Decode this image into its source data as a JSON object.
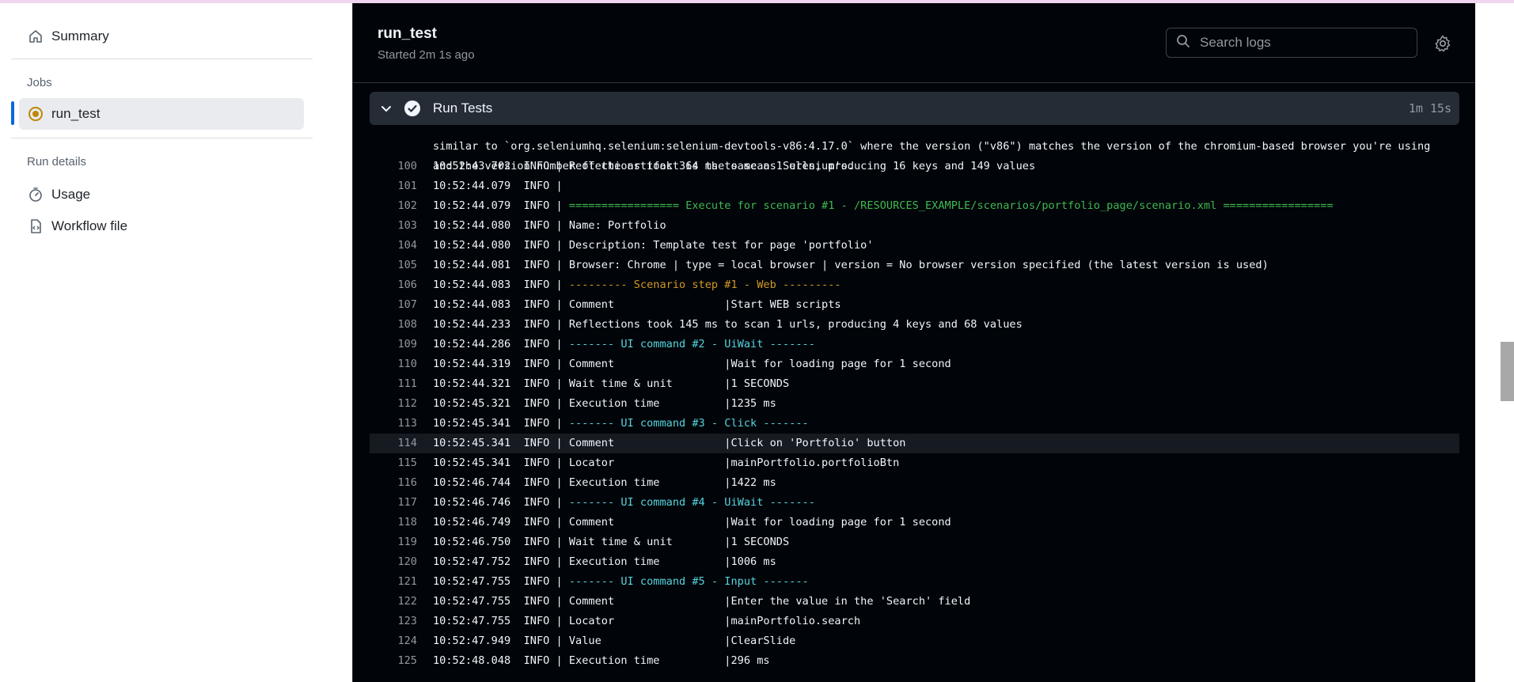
{
  "sidebar": {
    "summary": "Summary",
    "jobs_heading": "Jobs",
    "job": "run_test",
    "run_details_heading": "Run details",
    "usage": "Usage",
    "workflow_file": "Workflow file"
  },
  "header": {
    "title": "run_test",
    "subtitle": "Started 2m 1s ago",
    "search_placeholder": "Search logs"
  },
  "step": {
    "name": "Run Tests",
    "duration": "1m 15s"
  },
  "log": {
    "cont1": "similar to `org.seleniumhq.selenium:selenium-devtools-v86:4.17.0` where the version (\"v86\") matches the version of the chromium-based browser you're using",
    "cont2": "and the version number of the artifact is the same as Selenium's.",
    "lines": [
      {
        "n": "100",
        "t": "10:52:43.702  INFO | ",
        "m": "Reflections took 364 ms to scan 1 urls, producing 16 keys and 149 values"
      },
      {
        "n": "101",
        "t": "10:52:44.079  INFO | ",
        "m": ""
      },
      {
        "n": "102",
        "t": "10:52:44.079  INFO | ",
        "m": "================= Execute for scenario #1 - /RESOURCES_EXAMPLE/scenarios/portfolio_page/scenario.xml ================="
      },
      {
        "n": "103",
        "t": "10:52:44.080  INFO | ",
        "m": "Name: Portfolio"
      },
      {
        "n": "104",
        "t": "10:52:44.080  INFO | ",
        "m": "Description: Template test for page 'portfolio'"
      },
      {
        "n": "105",
        "t": "10:52:44.081  INFO | ",
        "m": "Browser: Chrome | type = local browser | version = No browser version specified (the latest version is used)"
      },
      {
        "n": "106",
        "t": "10:52:44.083  INFO | ",
        "m": "--------- Scenario step #1 - Web ---------"
      },
      {
        "n": "107",
        "t": "10:52:44.083  INFO | ",
        "m": "Comment                 |Start WEB scripts"
      },
      {
        "n": "108",
        "t": "10:52:44.233  INFO | ",
        "m": "Reflections took 145 ms to scan 1 urls, producing 4 keys and 68 values"
      },
      {
        "n": "109",
        "t": "10:52:44.286  INFO | ",
        "m": "------- UI command #2 - UiWait -------"
      },
      {
        "n": "110",
        "t": "10:52:44.319  INFO | ",
        "m": "Comment                 |Wait for loading page for 1 second"
      },
      {
        "n": "111",
        "t": "10:52:44.321  INFO | ",
        "m": "Wait time & unit        |1 SECONDS"
      },
      {
        "n": "112",
        "t": "10:52:45.321  INFO | ",
        "m": "Execution time          |1235 ms"
      },
      {
        "n": "113",
        "t": "10:52:45.341  INFO | ",
        "m": "------- UI command #3 - Click -------"
      },
      {
        "n": "114",
        "t": "10:52:45.341  INFO | ",
        "m": "Comment                 |Click on 'Portfolio' button"
      },
      {
        "n": "115",
        "t": "10:52:45.341  INFO | ",
        "m": "Locator                 |mainPortfolio.portfolioBtn"
      },
      {
        "n": "116",
        "t": "10:52:46.744  INFO | ",
        "m": "Execution time          |1422 ms"
      },
      {
        "n": "117",
        "t": "10:52:46.746  INFO | ",
        "m": "------- UI command #4 - UiWait -------"
      },
      {
        "n": "118",
        "t": "10:52:46.749  INFO | ",
        "m": "Comment                 |Wait for loading page for 1 second"
      },
      {
        "n": "119",
        "t": "10:52:46.750  INFO | ",
        "m": "Wait time & unit        |1 SECONDS"
      },
      {
        "n": "120",
        "t": "10:52:47.752  INFO | ",
        "m": "Execution time          |1006 ms"
      },
      {
        "n": "121",
        "t": "10:52:47.755  INFO | ",
        "m": "------- UI command #5 - Input -------"
      },
      {
        "n": "122",
        "t": "10:52:47.755  INFO | ",
        "m": "Comment                 |Enter the value in the 'Search' field"
      },
      {
        "n": "123",
        "t": "10:52:47.755  INFO | ",
        "m": "Locator                 |mainPortfolio.search"
      },
      {
        "n": "124",
        "t": "10:52:47.949  INFO | ",
        "m": "Value                   |ClearSlide"
      },
      {
        "n": "125",
        "t": "10:52:48.048  INFO | ",
        "m": "Execution time          |296 ms"
      }
    ]
  },
  "colors": {
    "scenario_header": "#3fb950",
    "scenario_step": "#d29922",
    "ui_command": "#56d4dd"
  }
}
